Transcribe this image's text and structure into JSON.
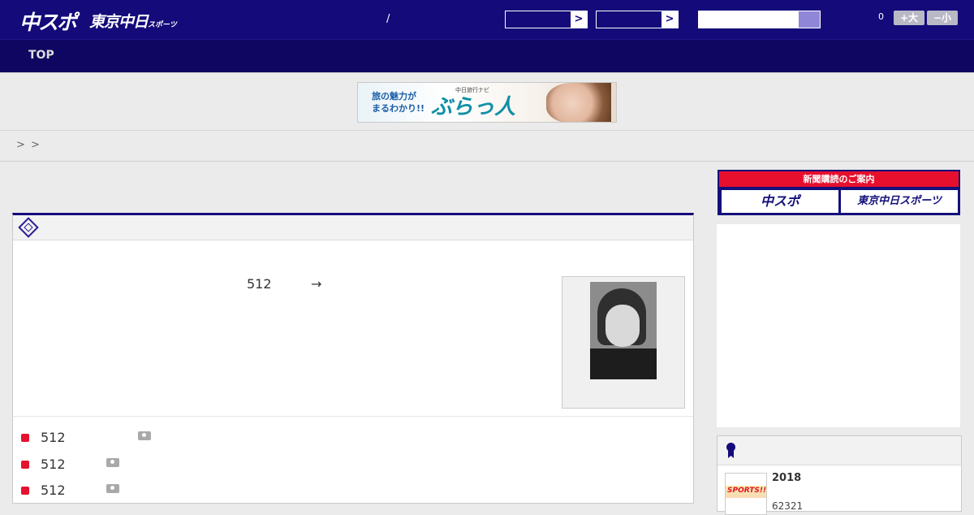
{
  "header": {
    "logo_main": "中スポ",
    "logo_tokyo": "東京中日",
    "logo_tokyo_small": "スポーツ",
    "date_separator": "/",
    "select_arrow_1": ">",
    "select_arrow_2": ">",
    "font_count": "0",
    "font_larger": "+大",
    "font_smaller": "−小",
    "colors": {
      "header_bg": "#140a7a",
      "accent_red": "#e4122e",
      "search_btn": "#8f86d8"
    }
  },
  "nav": {
    "items": [
      {
        "label": "TOP"
      }
    ]
  },
  "banner": {
    "line1": "旅の魅力が",
    "line2": "まるわかり!!",
    "brand_small": "中日旅行ナビ",
    "brand_large": "ぶらっ人"
  },
  "breadcrumb": {
    "sep1": ">",
    "sep2": ">"
  },
  "article": {
    "head_icon": "tag-icon",
    "lead_number": "512",
    "lead_arrow": "→",
    "related": [
      {
        "text": "512",
        "icon": "camera-icon"
      },
      {
        "text": "512",
        "icon": "camera-icon"
      },
      {
        "text": "512",
        "icon": "camera-icon"
      }
    ]
  },
  "sidebar": {
    "subscribe_title": "新聞購読のご案内",
    "subscribe_chuspo": "中スポ",
    "subscribe_tokyo": "東京中日スポーツ",
    "ranking": {
      "icon": "ribbon-icon",
      "thumb_text": "SPORTS!!",
      "title": "2018",
      "sub": "62321"
    }
  }
}
